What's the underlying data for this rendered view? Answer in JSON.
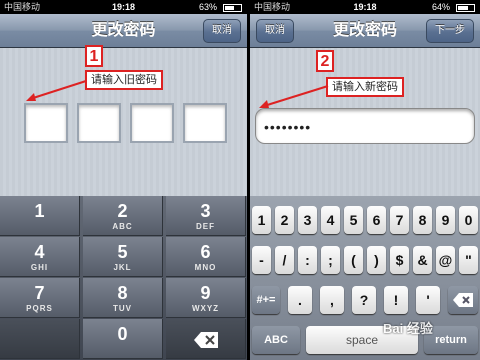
{
  "left": {
    "status": {
      "carrier": "中国移动",
      "time": "19:18",
      "battery": "63%",
      "battery_level": 0.63
    },
    "nav": {
      "title": "更改密码",
      "right_button": "取消"
    },
    "annotation": {
      "number": "1",
      "label": "请输入旧密码"
    },
    "numpad": [
      {
        "digit": "1",
        "letters": ""
      },
      {
        "digit": "2",
        "letters": "ABC"
      },
      {
        "digit": "3",
        "letters": "DEF"
      },
      {
        "digit": "4",
        "letters": "GHI"
      },
      {
        "digit": "5",
        "letters": "JKL"
      },
      {
        "digit": "6",
        "letters": "MNO"
      },
      {
        "digit": "7",
        "letters": "PQRS"
      },
      {
        "digit": "8",
        "letters": "TUV"
      },
      {
        "digit": "9",
        "letters": "WXYZ"
      },
      {
        "digit": "0",
        "letters": ""
      }
    ],
    "delete_icon": "delete-backspace-icon"
  },
  "right": {
    "status": {
      "carrier": "中国移动",
      "time": "19:18",
      "battery": "64%",
      "battery_level": 0.64
    },
    "nav": {
      "title": "更改密码",
      "left_button": "取消",
      "right_button": "下一步"
    },
    "annotation": {
      "number": "2",
      "label": "请输入新密码"
    },
    "password_value": "••••••••",
    "keyboard": {
      "row1": [
        "1",
        "2",
        "3",
        "4",
        "5",
        "6",
        "7",
        "8",
        "9",
        "0"
      ],
      "row2": [
        "-",
        "/",
        ":",
        ";",
        "(",
        ")",
        "$",
        "&",
        "@",
        "\""
      ],
      "row3_toggle": "#+=",
      "row3": [
        ".",
        ",",
        "?",
        "!",
        "'"
      ],
      "row4_abc": "ABC",
      "row4_space": "space",
      "row4_return": "return"
    }
  },
  "watermark": "Bai 经验"
}
